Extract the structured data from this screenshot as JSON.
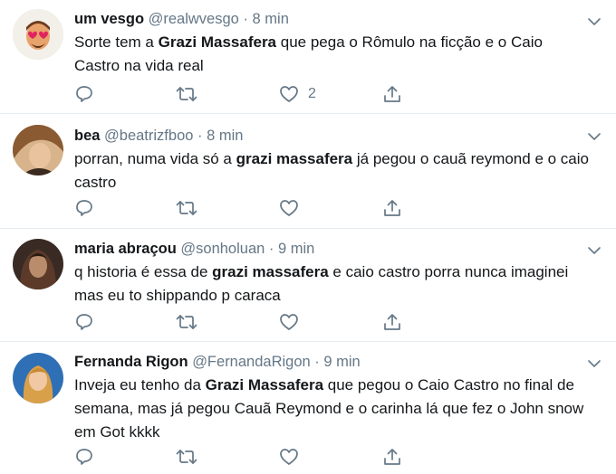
{
  "tweets": [
    {
      "name": "um vesgo",
      "handle": "@realwvesgo",
      "sep": "·",
      "time": "8 min",
      "text_parts": [
        "Sorte tem a ",
        "Grazi Massafera",
        " que pega o Rômulo na ficção e o Caio Castro na vida real"
      ],
      "like_count": "2",
      "avatar_color": "#f4efe6"
    },
    {
      "name": "bea",
      "handle": "@beatrizfboo",
      "sep": "·",
      "time": "8 min",
      "text_parts": [
        "porran, numa vida só a ",
        "grazi massafera",
        " já pegou o cauã reymond e o caio castro"
      ],
      "like_count": "",
      "avatar_color": "#c9a07a"
    },
    {
      "name": "maria abraçou",
      "handle": "@sonholuan",
      "sep": "·",
      "time": "9 min",
      "text_parts": [
        "q historia é essa de ",
        "grazi massafera",
        " e caio castro porra nunca imaginei mas eu to shippando p caraca"
      ],
      "like_count": "",
      "avatar_color": "#6b4a3a"
    },
    {
      "name": "Fernanda Rigon",
      "handle": "@FernandaRigon",
      "sep": "·",
      "time": "9 min",
      "text_parts": [
        "Inveja eu tenho da ",
        "Grazi Massafera",
        " que pegou o Caio Castro no final de semana, mas já pegou Cauã Reymond e o carinha lá que fez o John snow em Got kkkk"
      ],
      "like_count": "",
      "avatar_color": "#2f6fb5"
    }
  ],
  "icons": {
    "reply": "reply-icon",
    "retweet": "retweet-icon",
    "like": "like-icon",
    "share": "share-icon",
    "menu": "chevron-down-icon"
  },
  "colors": {
    "text": "#14171a",
    "muted": "#657786",
    "divider": "#e6ecf0"
  }
}
